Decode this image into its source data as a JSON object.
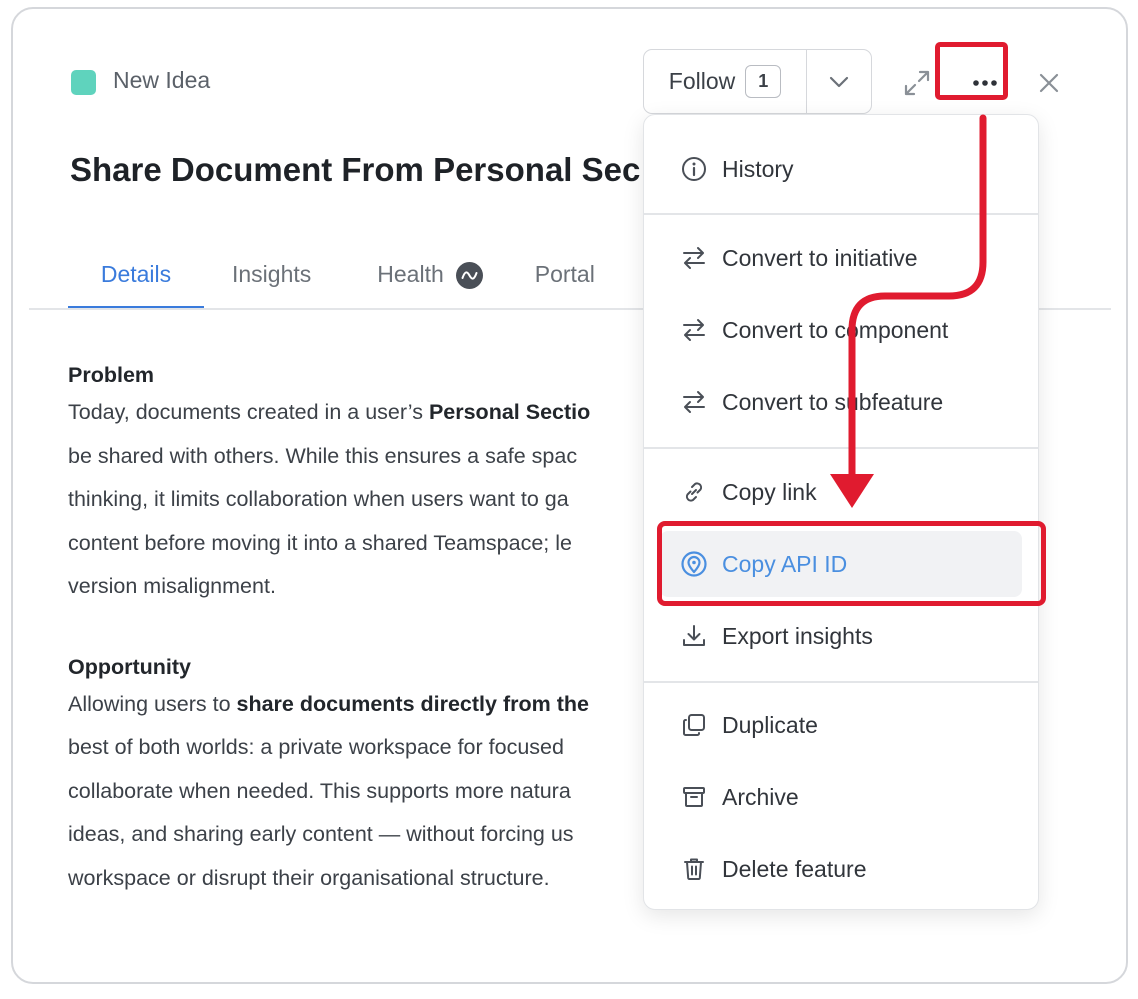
{
  "header": {
    "status_label": "New Idea",
    "status_color": "#5fd3bd",
    "follow_label": "Follow",
    "follow_count": "1",
    "icons": [
      "chevron-down-icon",
      "expand-icon",
      "more-dots-icon",
      "close-icon"
    ]
  },
  "title": "Share Document From Personal Sec",
  "tabs": [
    {
      "label": "Details",
      "active": true
    },
    {
      "label": "Insights",
      "active": false
    },
    {
      "label": "Health",
      "active": false
    },
    {
      "label": "Portal",
      "active": false
    }
  ],
  "content": {
    "problem_heading": "Problem",
    "problem_lines": [
      {
        "pre": "Today, documents created in a user’s ",
        "bold": "Personal Sectio",
        "post": ""
      },
      {
        "pre": "be shared with others. While this ensures a safe spac",
        "bold": "",
        "post": ""
      },
      {
        "pre": "thinking, it limits collaboration when users want to ga",
        "bold": "",
        "post": ""
      },
      {
        "pre": "content before moving it into a shared Teamspace; le",
        "bold": "",
        "post": ""
      },
      {
        "pre": "version misalignment.",
        "bold": "",
        "post": ""
      }
    ],
    "opportunity_heading": "Opportunity",
    "opportunity_lines": [
      {
        "pre": "Allowing users to ",
        "bold": "share documents directly from the",
        "post": ""
      },
      {
        "pre": "best of both worlds: a private workspace for focused",
        "bold": "",
        "post": ""
      },
      {
        "pre": "collaborate when needed. This supports more natura",
        "bold": "",
        "post": ""
      },
      {
        "pre": "ideas, and sharing early content — without forcing us",
        "bold": "",
        "post": ""
      },
      {
        "pre": "workspace or disrupt their organisational structure.",
        "bold": "",
        "post": ""
      }
    ]
  },
  "menu": {
    "history": "History",
    "convert_initiative": "Convert to initiative",
    "convert_component": "Convert to component",
    "convert_subfeature": "Convert to subfeature",
    "copy_link": "Copy link",
    "copy_api_id": "Copy API ID",
    "export_insights": "Export insights",
    "duplicate": "Duplicate",
    "archive": "Archive",
    "delete_feature": "Delete feature"
  },
  "colors": {
    "accent": "#3a7bdc",
    "highlight": "#e01b2f",
    "selected_text": "#4a8fe0"
  }
}
